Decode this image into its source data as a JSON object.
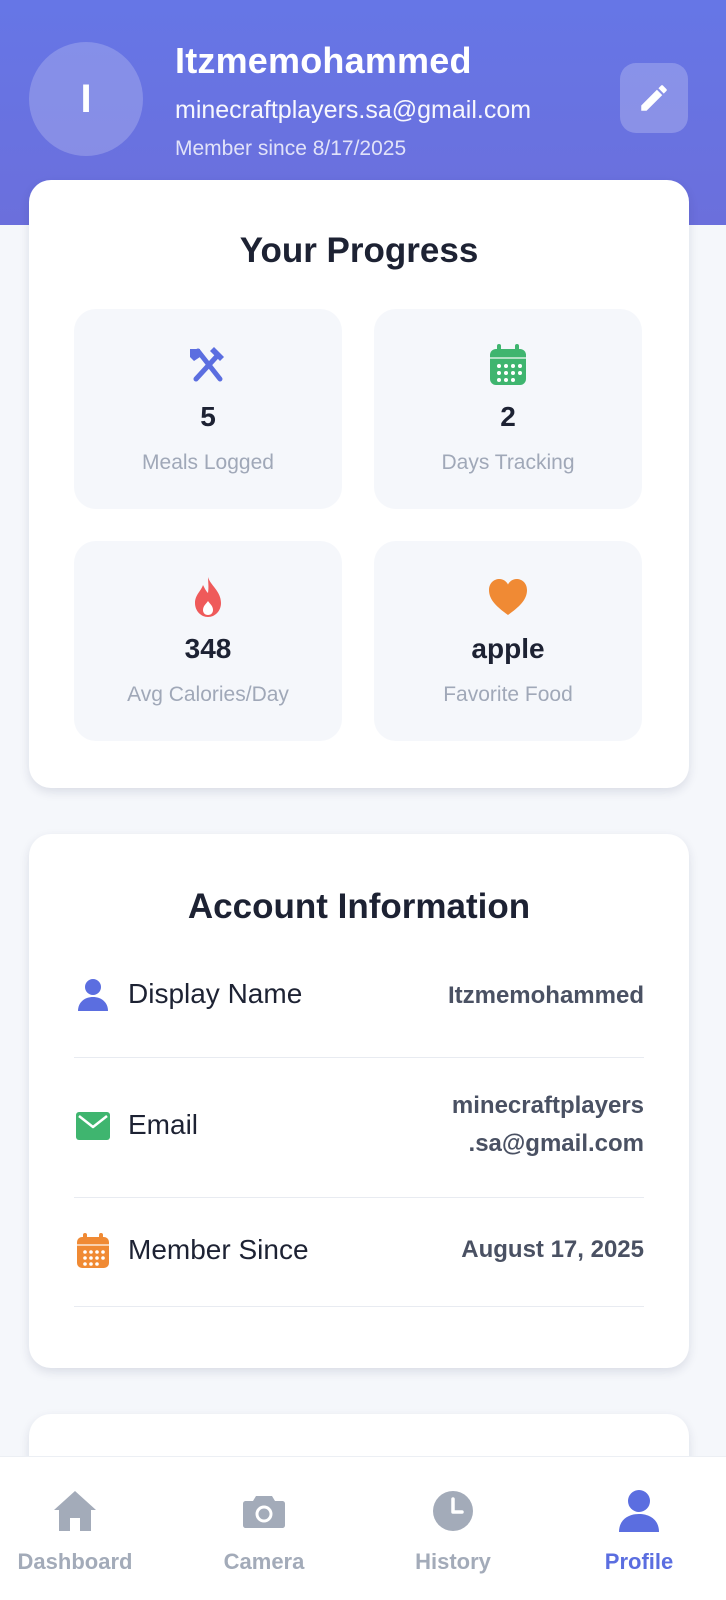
{
  "profile": {
    "initial": "I",
    "name": "Itzmemohammed",
    "email": "minecraftplayers.sa@gmail.com",
    "member_since": "Member since 8/17/2025"
  },
  "progress": {
    "title": "Your Progress",
    "stats": [
      {
        "icon": "utensils-icon",
        "value": "5",
        "label": "Meals Logged",
        "color": "#5b6ee0"
      },
      {
        "icon": "calendar-icon",
        "value": "2",
        "label": "Days Tracking",
        "color": "#3fb56f"
      },
      {
        "icon": "fire-icon",
        "value": "348",
        "label": "Avg Calories/Day",
        "color": "#ef5a5a"
      },
      {
        "icon": "heart-icon",
        "value": "apple",
        "label": "Favorite Food",
        "color": "#f08a34"
      }
    ]
  },
  "account": {
    "title": "Account Information",
    "rows": [
      {
        "icon": "user-icon",
        "label": "Display Name",
        "value": "Itzmemohammed"
      },
      {
        "icon": "envelope-icon",
        "label": "Email",
        "value_line1": "minecraftplayers",
        "value_line2": ".sa@gmail.com"
      },
      {
        "icon": "calendar-icon",
        "label": "Member Since",
        "value": "August 17, 2025"
      }
    ]
  },
  "nav": {
    "items": [
      {
        "icon": "home-icon",
        "label": "Dashboard",
        "active": false
      },
      {
        "icon": "camera-icon",
        "label": "Camera",
        "active": false
      },
      {
        "icon": "clock-icon",
        "label": "History",
        "active": false
      },
      {
        "icon": "user-icon",
        "label": "Profile",
        "active": true
      }
    ]
  },
  "colors": {
    "header": "#6676e6",
    "accent": "#5b6ee0",
    "green": "#3fb56f",
    "red": "#ef5a5a",
    "orange": "#f08a34",
    "inactive": "#a3abb9"
  }
}
